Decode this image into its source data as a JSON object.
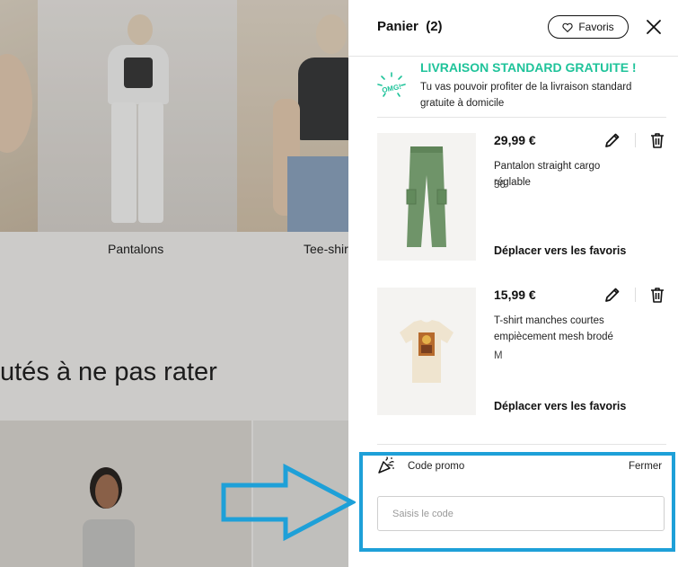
{
  "background": {
    "categories": [
      "Pantalons",
      "Tee-shirts"
    ],
    "section_title": "utés à ne pas rater"
  },
  "cart": {
    "title": "Panier",
    "count": "(2)",
    "favorites_label": "Favoris",
    "free_shipping": {
      "badge": "OMG!",
      "title": "LIVRAISON STANDARD GRATUITE !",
      "text": "Tu vas pouvoir profiter de la livraison standard gratuite à domicile"
    },
    "items": [
      {
        "price": "29,99 €",
        "name": "Pantalon straight cargo réglable",
        "size": "36",
        "move_label": "Déplacer vers les favoris"
      },
      {
        "price": "15,99 €",
        "name": "T-shirt manches courtes empiècement mesh brodé",
        "size": "M",
        "move_label": "Déplacer vers les favoris"
      }
    ],
    "promo": {
      "label": "Code promo",
      "close_label": "Fermer",
      "placeholder": "Saisis le code",
      "value": ""
    }
  },
  "colors": {
    "accent_green": "#1fc39a",
    "highlight_blue": "#1ea0d8"
  }
}
